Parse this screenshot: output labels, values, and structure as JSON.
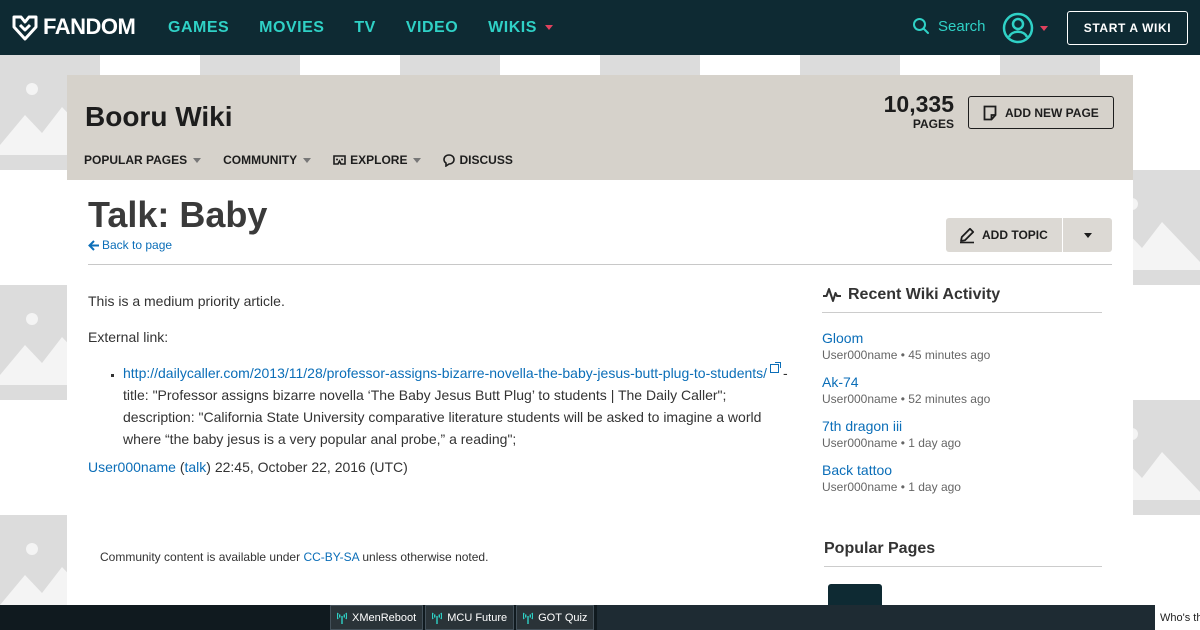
{
  "global_nav": {
    "logo_text": "FANDOM",
    "links": [
      {
        "label": "GAMES",
        "dropdown": false
      },
      {
        "label": "MOVIES",
        "dropdown": false
      },
      {
        "label": "TV",
        "dropdown": false
      },
      {
        "label": "VIDEO",
        "dropdown": false
      },
      {
        "label": "WIKIS",
        "dropdown": true
      }
    ],
    "search_label": "Search",
    "start_wiki_label": "START A WIKI"
  },
  "wiki_header": {
    "title": "Booru Wiki",
    "page_count": "10,335",
    "page_count_label": "PAGES",
    "add_page_label": "ADD NEW PAGE",
    "nav": [
      {
        "label": "POPULAR PAGES",
        "icon": "",
        "dropdown": true
      },
      {
        "label": "COMMUNITY",
        "icon": "",
        "dropdown": true
      },
      {
        "label": "EXPLORE",
        "icon": "explore-icon",
        "dropdown": true
      },
      {
        "label": "DISCUSS",
        "icon": "discuss-icon",
        "dropdown": false
      }
    ]
  },
  "page": {
    "title": "Talk: Baby",
    "back_label": "Back to page",
    "add_topic_label": "ADD TOPIC",
    "para1": "This is a medium priority article.",
    "para2": "External link:",
    "link_url": "http://dailycaller.com/2013/11/28/professor-assigns-bizarre-novella-the-baby-jesus-butt-plug-to-students/",
    "link_desc": " - title: \"Professor assigns bizarre novella ‘The Baby Jesus Butt Plug’ to students | The Daily Caller\"; description: \"California State University comparative literature students will be asked to imagine a world where “the baby jesus is a very popular anal probe,” a reading\";",
    "sig_user": "User000name",
    "sig_open": " (",
    "sig_talk": "talk",
    "sig_close": ") 22:45, October 22, 2016 (UTC)",
    "footer_pre": "Community content is available under ",
    "footer_link": "CC-BY-SA",
    "footer_post": " unless otherwise noted."
  },
  "recent_activity": {
    "heading": "Recent Wiki Activity",
    "items": [
      {
        "title": "Gloom",
        "user": "User000name",
        "sep": " • ",
        "time": "45 minutes ago"
      },
      {
        "title": "Ak-74",
        "user": "User000name",
        "sep": " • ",
        "time": "52 minutes ago"
      },
      {
        "title": "7th dragon iii",
        "user": "User000name",
        "sep": " • ",
        "time": "1 day ago"
      },
      {
        "title": "Back tattoo",
        "user": "User000name",
        "sep": " • ",
        "time": "1 day ago"
      }
    ]
  },
  "popular_pages": {
    "heading": "Popular Pages"
  },
  "bottom_bar": {
    "tabs": [
      "XMenReboot",
      "MCU Future",
      "GOT Quiz"
    ],
    "right_text": "Who's th"
  },
  "colors": {
    "nav_bg": "#0e2a33",
    "nav_link": "#2fd1c6",
    "accent_caret": "#e0415d",
    "wiki_header_bg": "#d6d2cb",
    "link": "#0b6eb8"
  }
}
